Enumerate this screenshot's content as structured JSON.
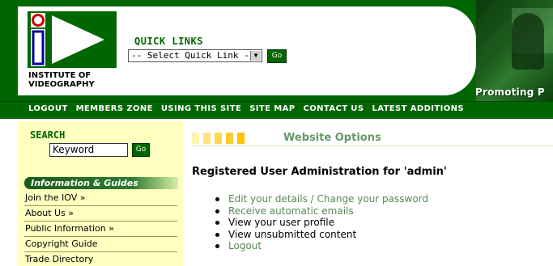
{
  "header": {
    "logo_text_line1": "INSTITUTE OF",
    "logo_text_line2": "VIDEOGRAPHY",
    "tagline": "Promoting P"
  },
  "quick_links": {
    "title": "QUICK LINKS",
    "select_value": "-- Select Quick Link --",
    "go_label": "Go"
  },
  "nav": {
    "items": [
      "LOGOUT",
      "MEMBERS ZONE",
      "USING THIS SITE",
      "SITE MAP",
      "CONTACT US",
      "LATEST ADDITIONS"
    ]
  },
  "search": {
    "title": "SEARCH",
    "input_value": "Keyword",
    "go_label": "Go"
  },
  "guides": {
    "header": "Information & Guides",
    "items": [
      "Join the IOV »",
      "About Us »",
      "Public Information »",
      "Copyright Guide",
      "Trade Directory"
    ]
  },
  "main": {
    "section_title": "Website Options",
    "heading": "Registered User Administration for 'admin'",
    "options": [
      "Edit your details / Change your password",
      "Receive automatic emails",
      "View your user profile",
      "View unsubmitted content",
      "Logout"
    ]
  },
  "colors": {
    "brand_green": "#006600",
    "sidebar_bg": "#ffffc0",
    "link_green": "#558855",
    "stripe_1": "#fff3b0",
    "stripe_2": "#ffe680",
    "stripe_3": "#ffd94d",
    "stripe_4": "#ffcc33",
    "stripe_5": "#ffc200"
  }
}
